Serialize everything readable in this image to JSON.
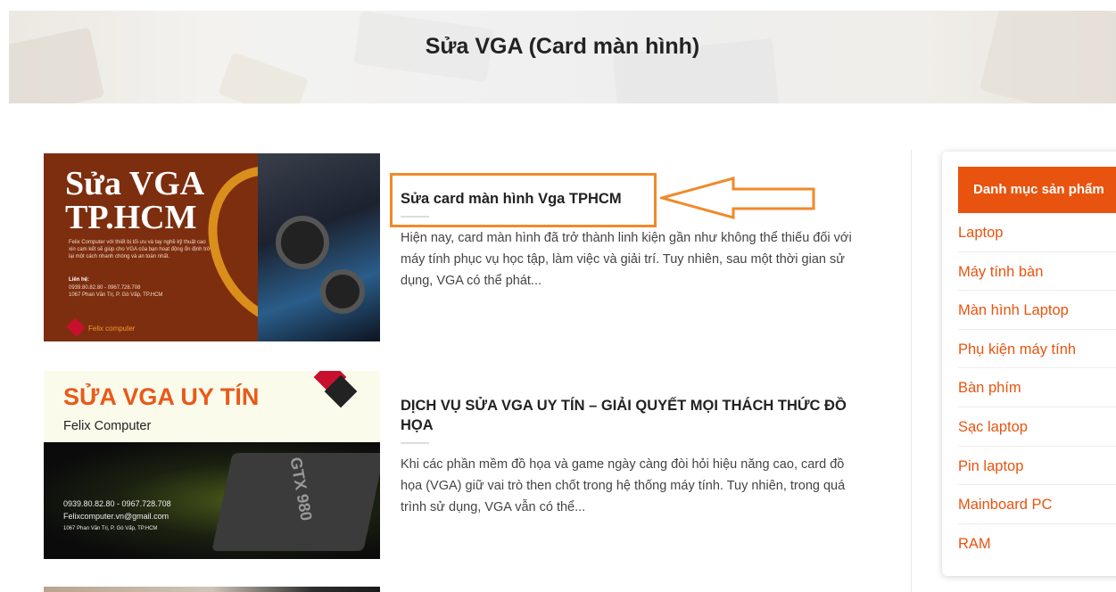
{
  "page": {
    "title": "Sửa VGA (Card màn hình)"
  },
  "posts": [
    {
      "title": "Sửa card màn hình Vga TPHCM",
      "excerpt": "Hiện nay, card màn hình đã trở thành linh kiện gần như không thể thiếu đối với máy tính phục vụ học tập, làm việc và giải trí. Tuy nhiên, sau một thời gian sử dụng, VGA có thể phát...",
      "thumbnail": {
        "line1": "Sửa VGA",
        "line2": "TP.HCM",
        "blurb": "Felix Computer với thiết bị tối ưu và tay nghề kỹ thuật cao xin cam kết sẽ giúp cho VGA của bạn hoạt động ổn định trở lại một cách nhanh chóng và an toàn nhất.",
        "contact_label": "Liên hệ:",
        "contact_phone": "0939.80.82.80 - 0967.728.708",
        "contact_address": "1067 Phan Văn Trị, P. Gò Vấp, TP.HCM",
        "brand": "Felix computer"
      }
    },
    {
      "title": "DỊCH VỤ SỬA VGA UY TÍN – GIẢI QUYẾT MỌI THÁCH THỨC ĐỒ HỌA",
      "excerpt": "Khi các phần mềm đồ họa và game ngày càng đòi hỏi hiệu năng cao, card đồ họa (VGA) giữ vai trò then chốt trong hệ thống máy tính. Tuy nhiên, trong quá trình sử dụng, VGA vẫn có thể...",
      "thumbnail": {
        "headline": "SỬA VGA UY TÍN",
        "sub": "Felix Computer",
        "card_label": "GTX 980",
        "phone": "0939.80.82.80 - 0967.728.708",
        "email": "Felixcomputer.vn@gmail.com",
        "address": "1067 Phan Văn Trị, P. Gò Vấp, TP.HCM"
      }
    }
  ],
  "sidebar": {
    "heading": "Danh mục sản phẩm",
    "items": [
      "Laptop",
      "Máy tính bàn",
      "Màn hình Laptop",
      "Phụ kiện máy tính",
      "Bàn phím",
      "Sạc laptop",
      "Pin laptop",
      "Mainboard PC",
      "RAM"
    ]
  },
  "colors": {
    "accent": "#e8540f",
    "highlight": "#f08a2a"
  }
}
